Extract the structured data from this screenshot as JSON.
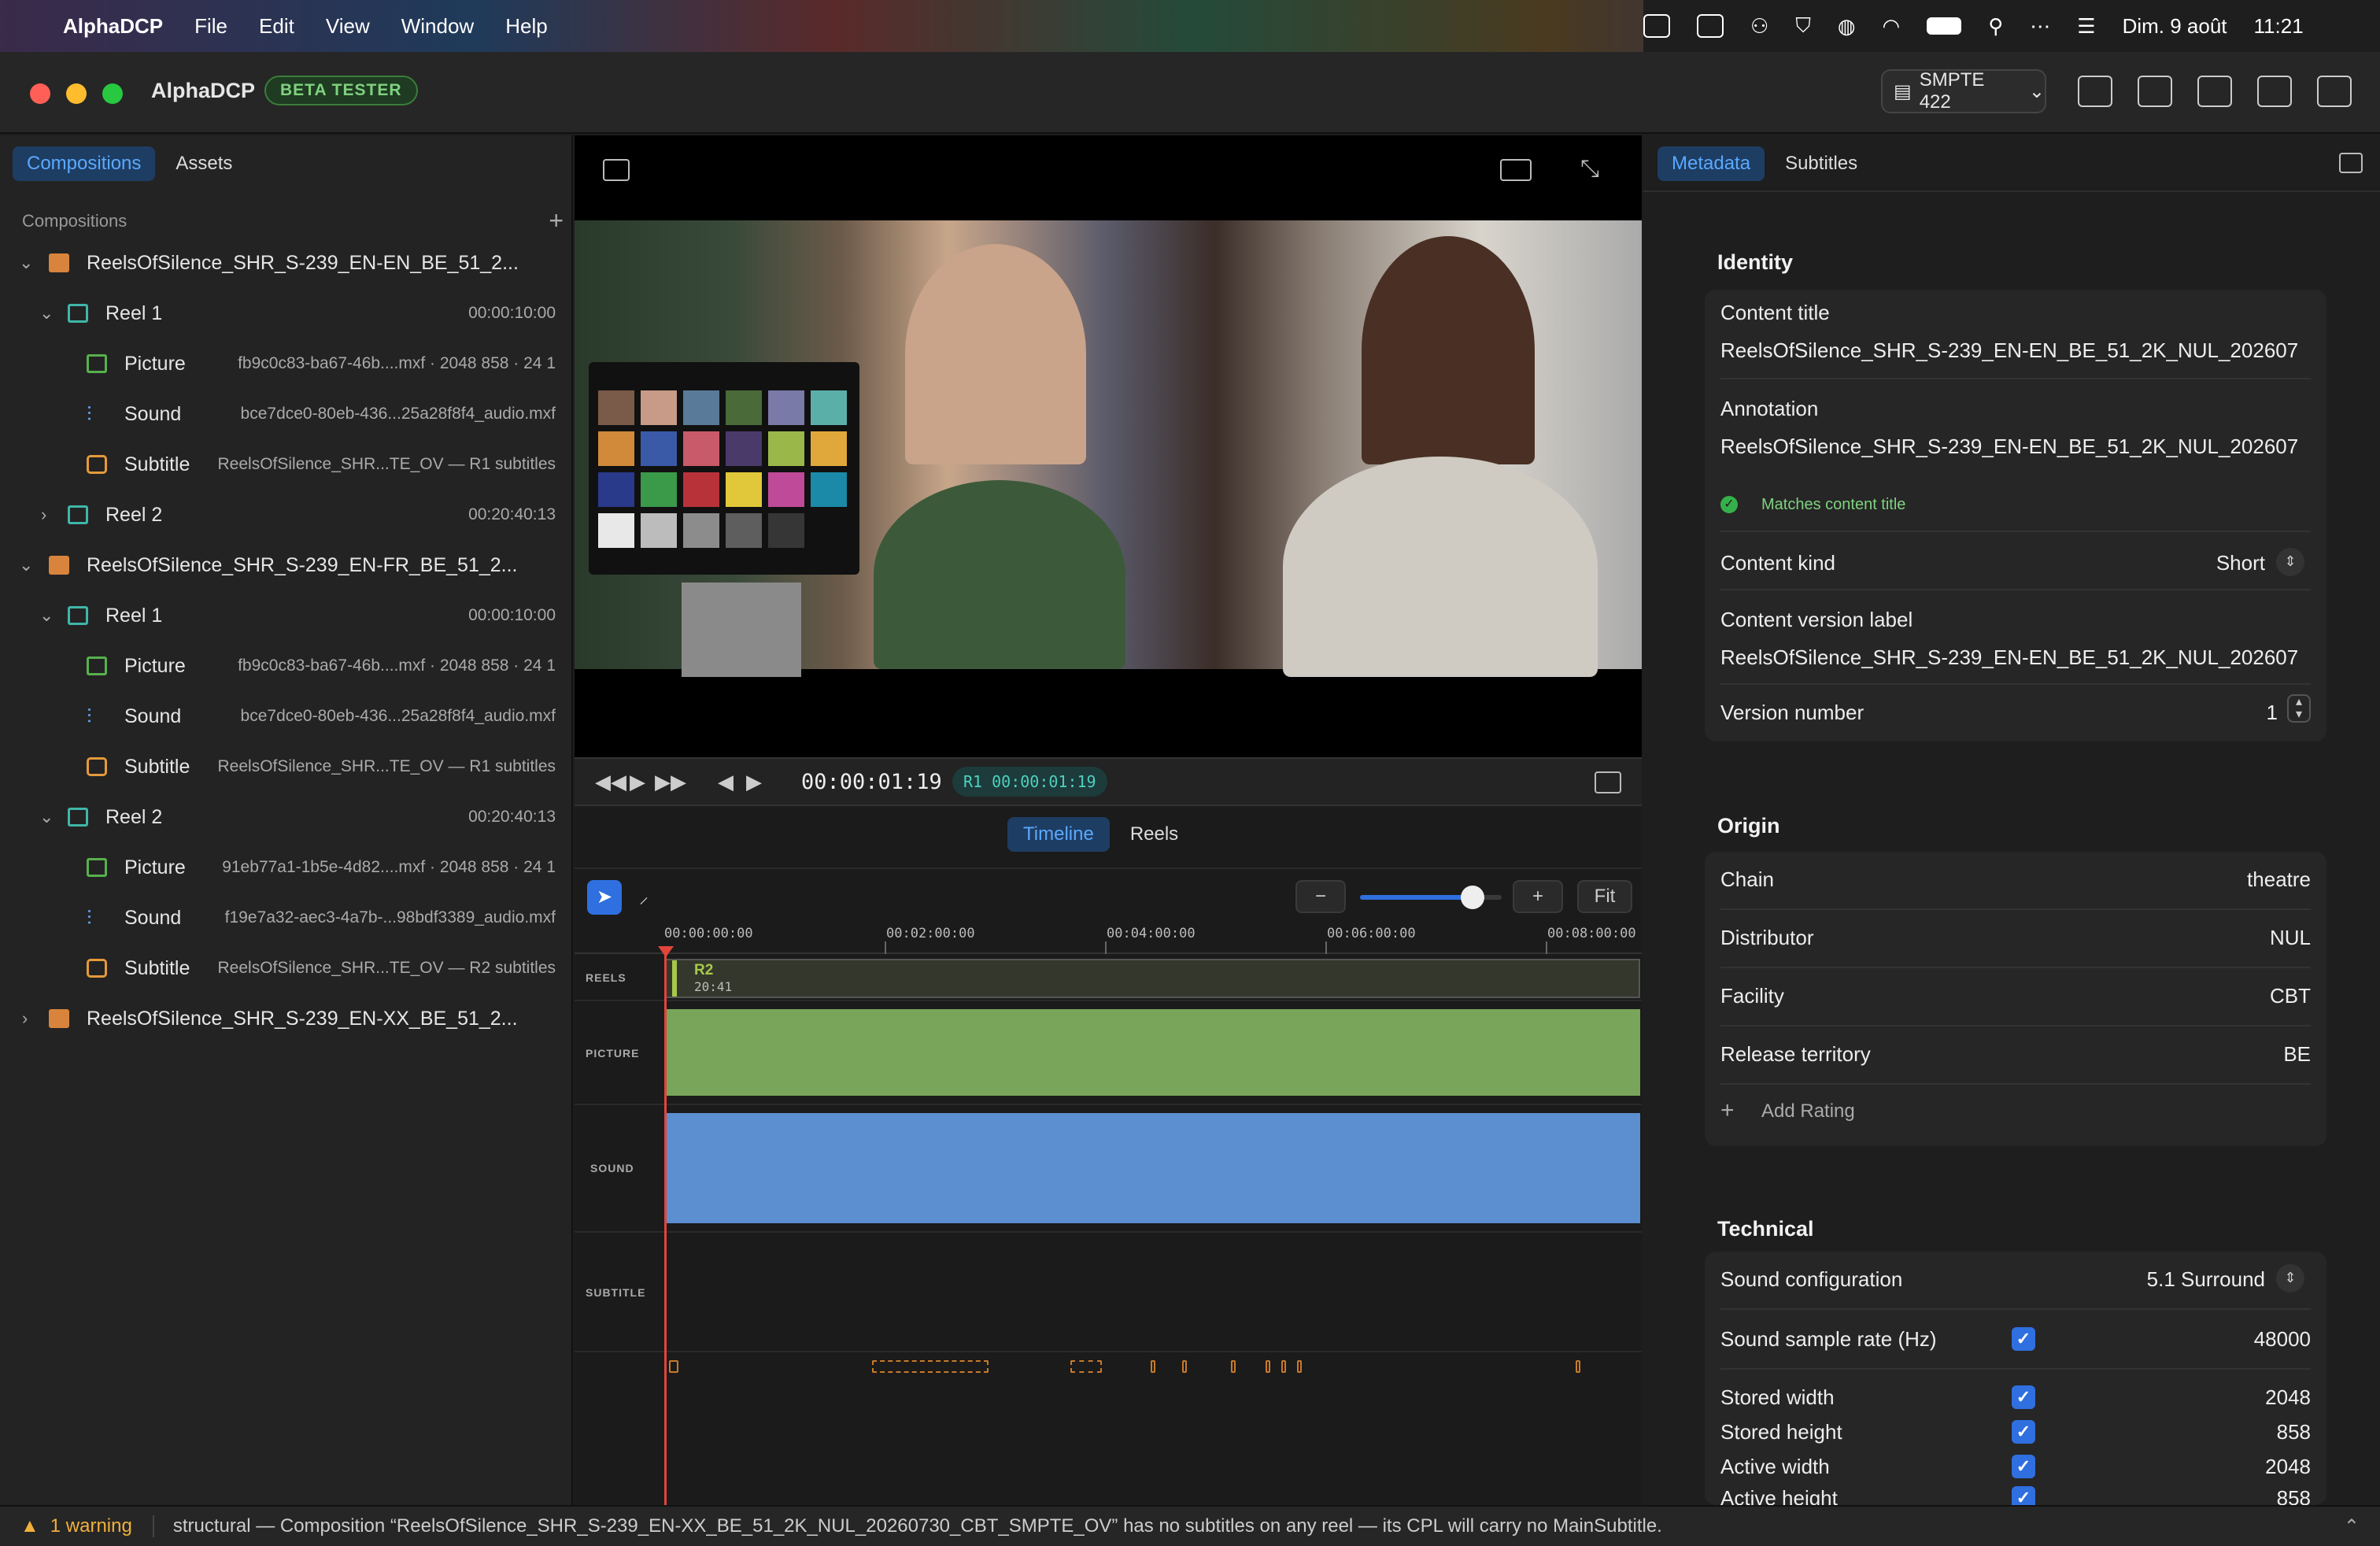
{
  "menubar": {
    "app": "AlphaDCP",
    "items": [
      "File",
      "Edit",
      "View",
      "Window",
      "Help"
    ],
    "clock_date": "Dim. 9 août",
    "clock_time": "11:21"
  },
  "titlebar": {
    "title": "AlphaDCP",
    "badge": "BETA TESTER",
    "standard_label": "SMPTE 422"
  },
  "left": {
    "tabs": [
      "Compositions",
      "Assets"
    ],
    "section_label": "Compositions",
    "rows": [
      {
        "name": "ReelsOfSilence_SHR_S-239_EN-EN_BE_51_2...",
        "detail": ""
      },
      {
        "name": "Reel 1",
        "detail": "00:00:10:00"
      },
      {
        "name": "Picture",
        "detail": "fb9c0c83-ba67-46b....mxf · 2048 858 · 24 1"
      },
      {
        "name": "Sound",
        "detail": "bce7dce0-80eb-436...25a28f8f4_audio.mxf"
      },
      {
        "name": "Subtitle",
        "detail": "ReelsOfSilence_SHR...TE_OV — R1 subtitles"
      },
      {
        "name": "Reel 2",
        "detail": "00:20:40:13"
      },
      {
        "name": "ReelsOfSilence_SHR_S-239_EN-FR_BE_51_2...",
        "detail": ""
      },
      {
        "name": "Reel 1",
        "detail": "00:00:10:00"
      },
      {
        "name": "Picture",
        "detail": "fb9c0c83-ba67-46b....mxf · 2048 858 · 24 1"
      },
      {
        "name": "Sound",
        "detail": "bce7dce0-80eb-436...25a28f8f4_audio.mxf"
      },
      {
        "name": "Subtitle",
        "detail": "ReelsOfSilence_SHR...TE_OV — R1 subtitles"
      },
      {
        "name": "Reel 2",
        "detail": "00:20:40:13"
      },
      {
        "name": "Picture",
        "detail": "91eb77a1-1b5e-4d82....mxf · 2048 858 · 24 1"
      },
      {
        "name": "Sound",
        "detail": "f19e7a32-aec3-4a7b-...98bdf3389_audio.mxf"
      },
      {
        "name": "Subtitle",
        "detail": "ReelsOfSilence_SHR...TE_OV — R2 subtitles"
      },
      {
        "name": "ReelsOfSilence_SHR_S-239_EN-XX_BE_51_2...",
        "detail": ""
      }
    ]
  },
  "player": {
    "timecode": "00:00:01:19",
    "reel_timecode": "R1 00:00:01:19",
    "tabs": [
      "Timeline",
      "Reels"
    ],
    "fit_label": "Fit",
    "ruler": [
      "00:00:00:00",
      "00:02:00:00",
      "00:04:00:00",
      "00:06:00:00",
      "00:08:00:00"
    ],
    "lanes": [
      "REELS",
      "PICTURE",
      "SOUND",
      "SUBTITLE"
    ],
    "reel_clip_name": "R2",
    "reel_clip_duration": "20:41"
  },
  "right": {
    "tabs": [
      "Metadata",
      "Subtitles"
    ],
    "identity": {
      "heading": "Identity",
      "content_title_label": "Content title",
      "content_title": "ReelsOfSilence_SHR_S-239_EN-EN_BE_51_2K_NUL_202607",
      "annotation_label": "Annotation",
      "annotation": "ReelsOfSilence_SHR_S-239_EN-EN_BE_51_2K_NUL_202607",
      "matches_note": "Matches content title",
      "content_kind_label": "Content kind",
      "content_kind": "Short",
      "version_label_label": "Content version label",
      "version_label": "ReelsOfSilence_SHR_S-239_EN-EN_BE_51_2K_NUL_202607",
      "version_number_label": "Version number",
      "version_number": "1"
    },
    "origin": {
      "heading": "Origin",
      "chain_label": "Chain",
      "chain": "theatre",
      "distributor_label": "Distributor",
      "distributor": "NUL",
      "facility_label": "Facility",
      "facility": "CBT",
      "territory_label": "Release territory",
      "territory": "BE",
      "add_rating": "Add Rating"
    },
    "technical": {
      "heading": "Technical",
      "sound_config_label": "Sound configuration",
      "sound_config": "5.1 Surround",
      "sample_rate_label": "Sound sample rate (Hz)",
      "sample_rate": "48000",
      "stored_width_label": "Stored width",
      "stored_width": "2048",
      "stored_height_label": "Stored height",
      "stored_height": "858",
      "active_width_label": "Active width",
      "active_width": "2048",
      "active_height_label": "Active height",
      "active_height": "858"
    }
  },
  "status": {
    "warning_count": "1 warning",
    "message": "structural — Composition “ReelsOfSilence_SHR_S-239_EN-XX_BE_51_2K_NUL_20260730_CBT_SMPTE_OV” has no subtitles on any reel — its CPL will carry no MainSubtitle."
  },
  "colors": {
    "accent": "#5aa9ff",
    "picture_lane": "#78a55a",
    "sound_lane": "#5b8fcf",
    "playhead": "#e0453a",
    "badge_green": "#7fd27f"
  }
}
